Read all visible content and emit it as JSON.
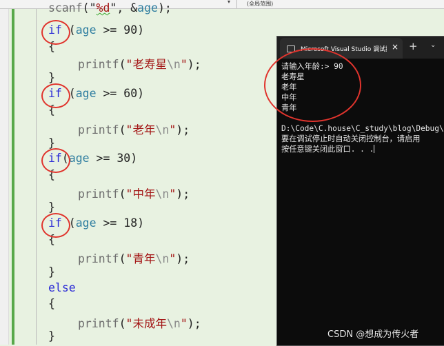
{
  "ide": {
    "scope_label": "(全局范围)",
    "code_lines": [
      {
        "id": "scanf",
        "parts": [
          [
            "fn",
            "scanf"
          ],
          [
            "txt",
            "(\""
          ],
          [
            "str",
            "%d"
          ],
          [
            "txt",
            "\", &"
          ],
          [
            "var",
            "age"
          ],
          [
            "txt",
            ");"
          ]
        ]
      },
      {
        "id": "if90",
        "parts": [
          [
            "kw",
            "if"
          ],
          [
            "txt",
            " ("
          ],
          [
            "var",
            "age"
          ],
          [
            "txt",
            " >= 90)"
          ]
        ]
      },
      {
        "id": "b1",
        "parts": [
          [
            "txt",
            "{"
          ]
        ]
      },
      {
        "id": "p1",
        "parts": [
          [
            "fn",
            "printf"
          ],
          [
            "txt",
            "("
          ],
          [
            "str",
            "\"老寿星"
          ],
          [
            "esc",
            "\\n"
          ],
          [
            "str",
            "\""
          ],
          [
            "txt",
            ");"
          ]
        ]
      },
      {
        "id": "e1",
        "parts": [
          [
            "txt",
            "}"
          ]
        ]
      },
      {
        "id": "if60",
        "parts": [
          [
            "kw",
            "if"
          ],
          [
            "txt",
            " ("
          ],
          [
            "var",
            "age"
          ],
          [
            "txt",
            " >= 60)"
          ]
        ]
      },
      {
        "id": "b2",
        "parts": [
          [
            "txt",
            "{"
          ]
        ]
      },
      {
        "id": "p2",
        "parts": [
          [
            "fn",
            "printf"
          ],
          [
            "txt",
            "("
          ],
          [
            "str",
            "\"老年"
          ],
          [
            "esc",
            "\\n"
          ],
          [
            "str",
            "\""
          ],
          [
            "txt",
            ");"
          ]
        ]
      },
      {
        "id": "e2",
        "parts": [
          [
            "txt",
            "}"
          ]
        ]
      },
      {
        "id": "if30",
        "parts": [
          [
            "kw",
            "if"
          ],
          [
            "txt",
            "("
          ],
          [
            "var",
            "age"
          ],
          [
            "txt",
            " >= 30)"
          ]
        ]
      },
      {
        "id": "b3",
        "parts": [
          [
            "txt",
            "{"
          ]
        ]
      },
      {
        "id": "p3",
        "parts": [
          [
            "fn",
            "printf"
          ],
          [
            "txt",
            "("
          ],
          [
            "str",
            "\"中年"
          ],
          [
            "esc",
            "\\n"
          ],
          [
            "str",
            "\""
          ],
          [
            "txt",
            ");"
          ]
        ]
      },
      {
        "id": "e3",
        "parts": [
          [
            "txt",
            "}"
          ]
        ]
      },
      {
        "id": "if18",
        "parts": [
          [
            "kw",
            "if"
          ],
          [
            "txt",
            " ("
          ],
          [
            "var",
            "age"
          ],
          [
            "txt",
            " >= 18)"
          ]
        ]
      },
      {
        "id": "b4",
        "parts": [
          [
            "txt",
            "{"
          ]
        ]
      },
      {
        "id": "p4",
        "parts": [
          [
            "fn",
            "printf"
          ],
          [
            "txt",
            "("
          ],
          [
            "str",
            "\"青年"
          ],
          [
            "esc",
            "\\n"
          ],
          [
            "str",
            "\""
          ],
          [
            "txt",
            ");"
          ]
        ]
      },
      {
        "id": "e4",
        "parts": [
          [
            "txt",
            "}"
          ]
        ]
      },
      {
        "id": "else",
        "parts": [
          [
            "kw",
            "else"
          ]
        ]
      },
      {
        "id": "b5",
        "parts": [
          [
            "txt",
            "{"
          ]
        ]
      },
      {
        "id": "p5",
        "parts": [
          [
            "fn",
            "printf"
          ],
          [
            "txt",
            "("
          ],
          [
            "str",
            "\"未成年"
          ],
          [
            "esc",
            "\\n"
          ],
          [
            "str",
            "\""
          ],
          [
            "txt",
            ");"
          ]
        ]
      },
      {
        "id": "e5",
        "parts": [
          [
            "txt",
            "}"
          ]
        ]
      }
    ]
  },
  "console": {
    "tab_title": "Microsoft Visual Studio 调试控制台",
    "new_tab": "+",
    "dropdown": "⌄",
    "close": "×",
    "output_lines": [
      "请输入年龄:> 90",
      "老寿星",
      "老年",
      "中年",
      "青年",
      "",
      "D:\\Code\\C.house\\C_study\\blog\\Debug\\b",
      "要在调试停止时自动关闭控制台，请启用",
      "按任意键关闭此窗口. . ."
    ]
  },
  "watermark": "CSDN @想成为传火者",
  "colors": {
    "annotation": "#e0342d",
    "keyword": "#2b2bd6",
    "string": "#a31515"
  }
}
